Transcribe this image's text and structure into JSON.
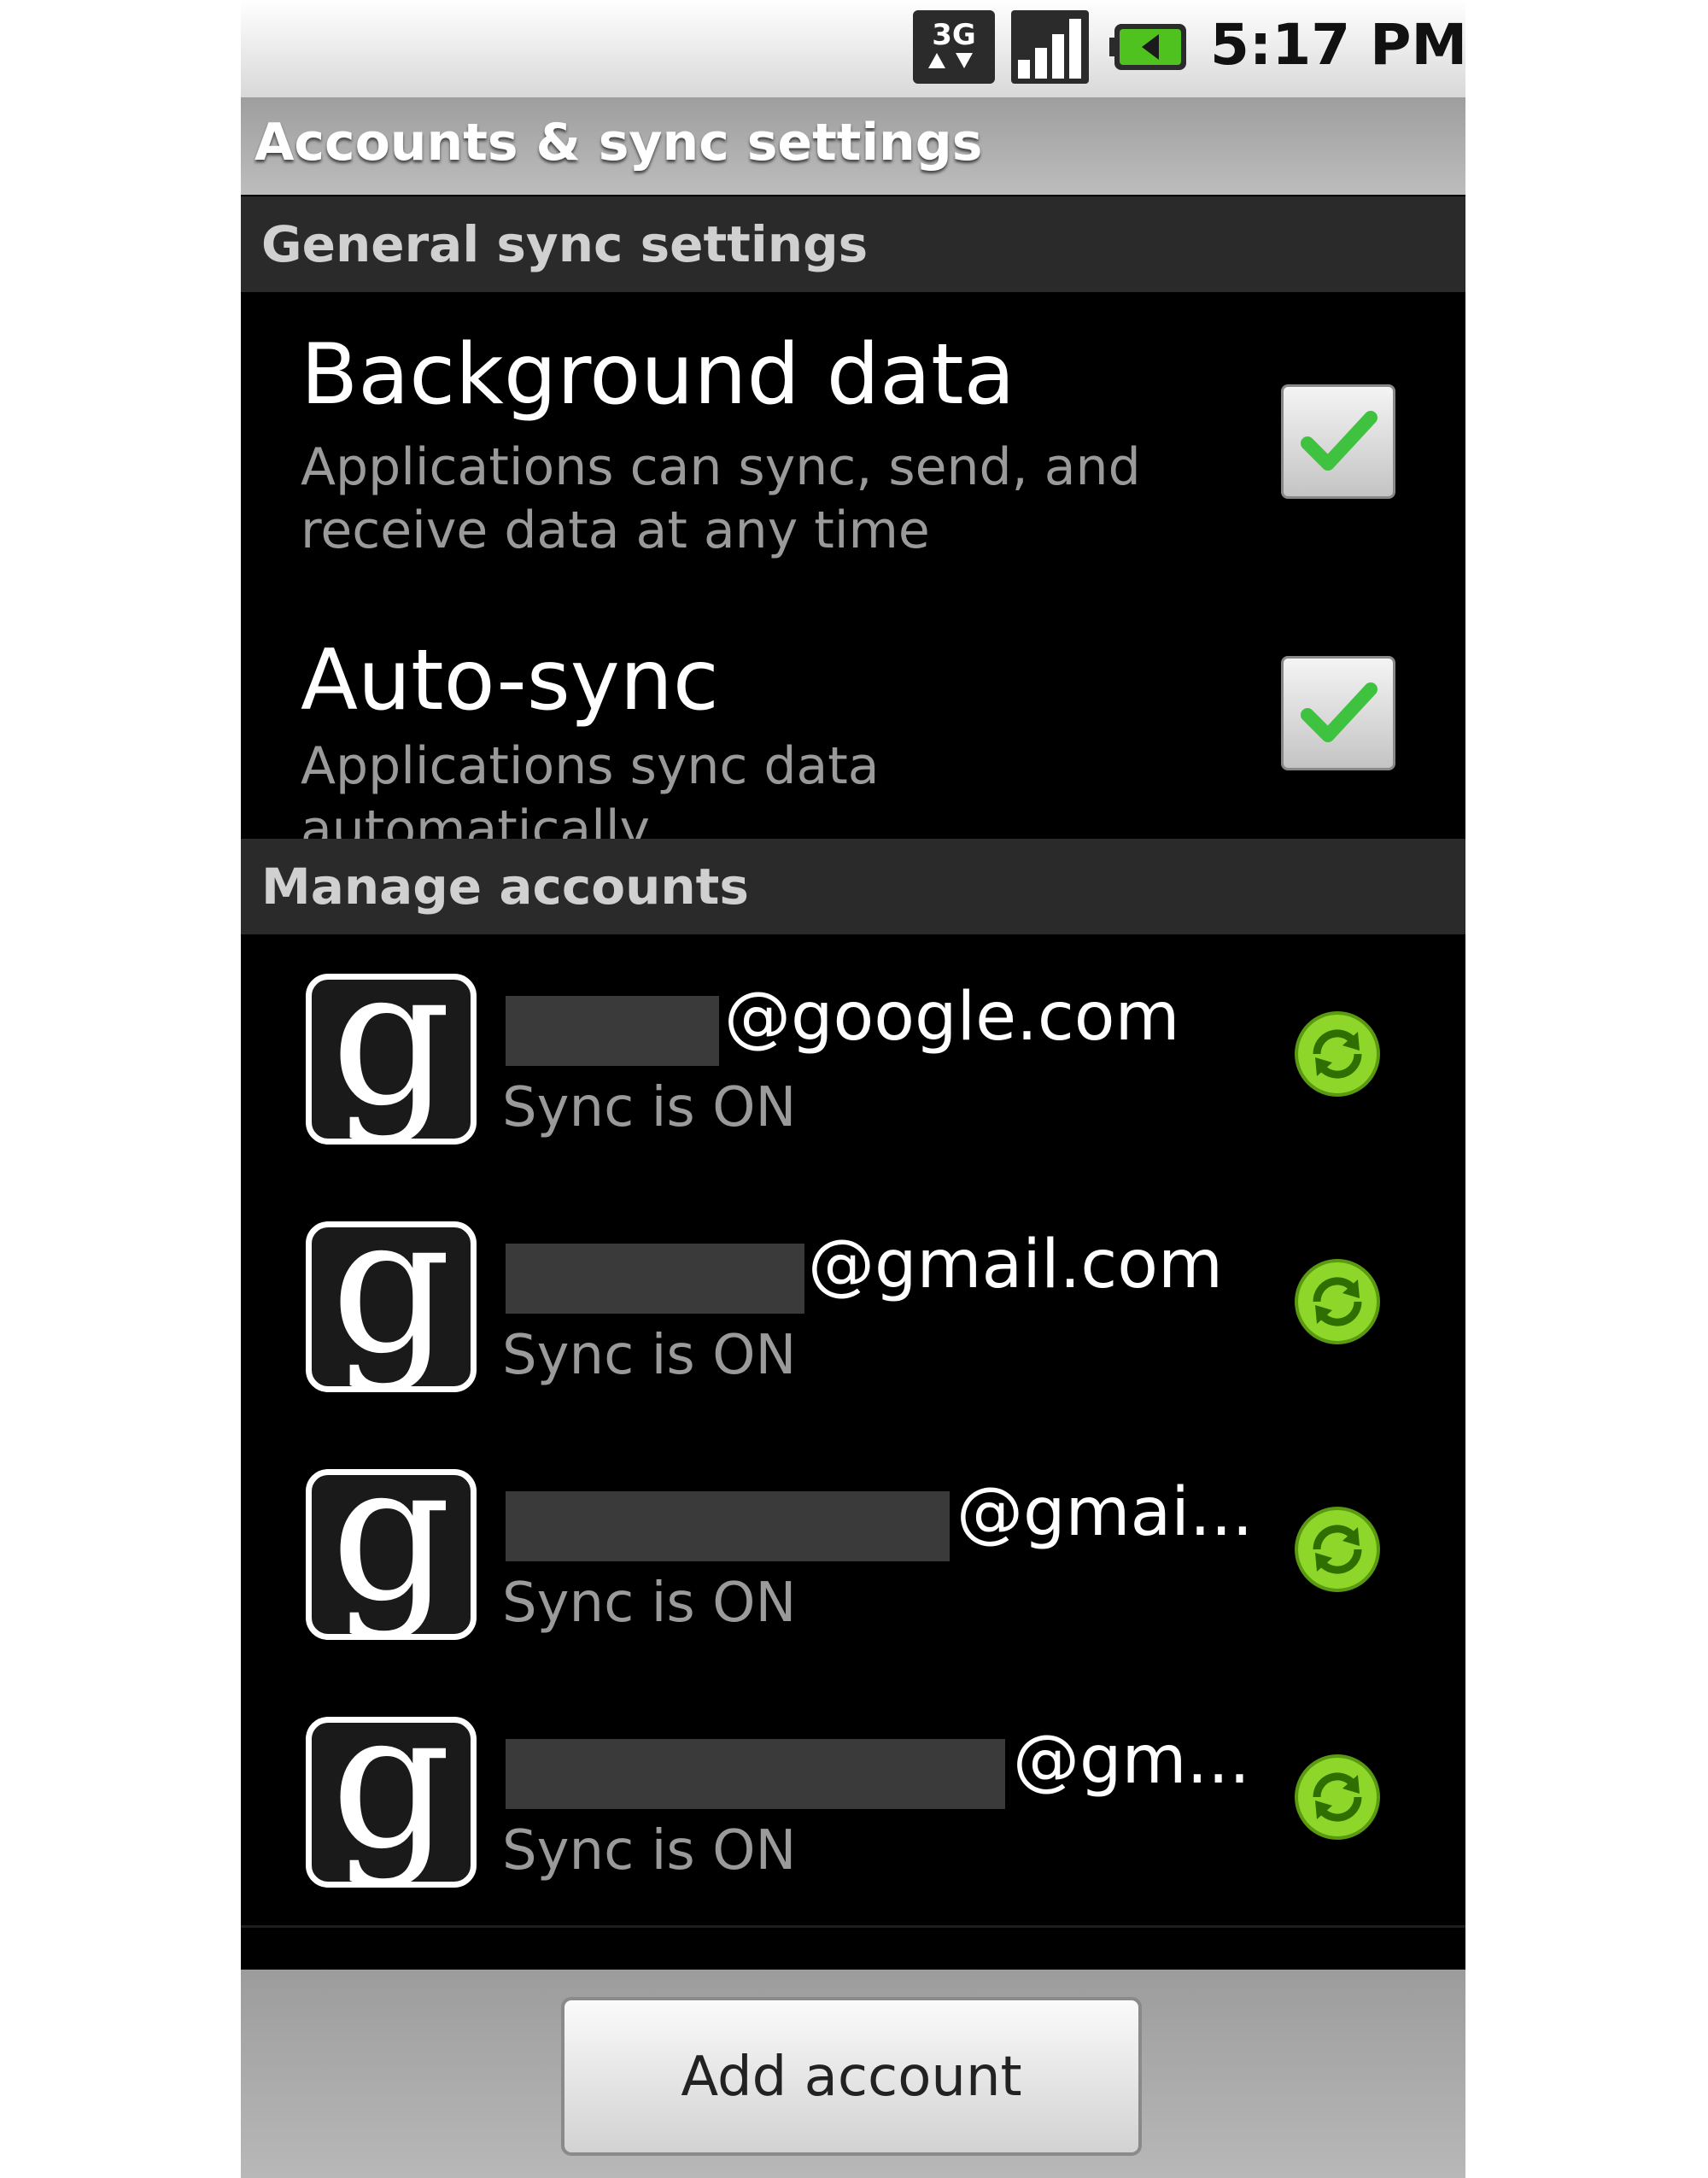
{
  "status_bar": {
    "network_label": "3G",
    "time": "5:17 PM",
    "icons": [
      "network-3g-icon",
      "signal-strength-icon",
      "battery-icon"
    ]
  },
  "title_bar": {
    "title": "Accounts & sync settings"
  },
  "general_sync": {
    "header": "General sync settings",
    "background_data": {
      "title": "Background data",
      "summary": "Applications can sync, send, and receive data at any time",
      "checked": true
    },
    "auto_sync": {
      "title": "Auto-sync",
      "summary": "Applications sync data automatically",
      "checked": true
    }
  },
  "manage_accounts": {
    "header": "Manage accounts",
    "accounts": [
      {
        "domain": "@google.com",
        "status": "Sync is ON"
      },
      {
        "domain": "@gmail.com",
        "status": "Sync is ON"
      },
      {
        "domain": "@gmai...",
        "status": "Sync is ON"
      },
      {
        "domain": "@gm...",
        "status": "Sync is ON"
      }
    ]
  },
  "footer": {
    "add_account_label": "Add account"
  },
  "colors": {
    "check_green": "#3fc23f",
    "sync_green": "#8fd62a",
    "background": "#000000",
    "section_header": "#2a2a2a"
  }
}
